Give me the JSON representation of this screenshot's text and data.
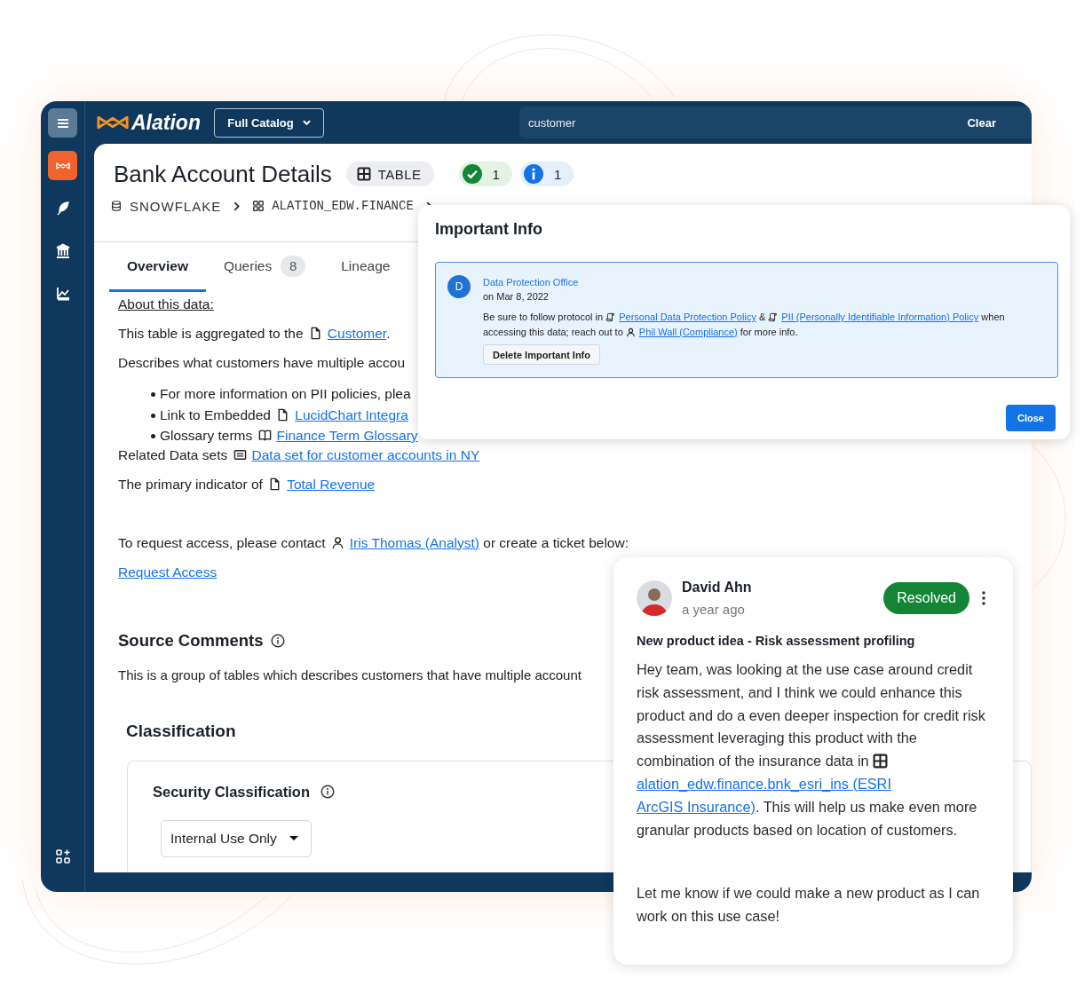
{
  "top_bar": {
    "logo": "Alation",
    "catalog_dropdown": "Full Catalog",
    "search": {
      "value": "customer"
    },
    "clear_button": "Clear"
  },
  "rail": [
    {
      "kind": "menu",
      "selected": false
    },
    {
      "kind": "catalog",
      "selected": true
    },
    {
      "kind": "compose",
      "selected": false
    },
    {
      "kind": "bank",
      "selected": false
    },
    {
      "kind": "chart",
      "selected": false
    },
    {
      "kind": "apps",
      "selected": false
    }
  ],
  "header": {
    "title": "Bank Account Details",
    "type_badge": "TABLE",
    "badges": [
      {
        "kind": "endorsed",
        "count": "1"
      },
      {
        "kind": "info",
        "count": "1"
      }
    ],
    "breadcrumb": [
      {
        "kind": "database",
        "label": "SNOWFLAKE"
      },
      {
        "kind": "schema",
        "label": "ALATION_EDW.FINANCE"
      }
    ]
  },
  "tabs": [
    {
      "label": "Overview",
      "selected": true
    },
    {
      "label": "Queries",
      "count": "8",
      "selected": false
    },
    {
      "label": "Lineage",
      "selected": false
    }
  ],
  "description": [
    {
      "kind": "label",
      "text": "About this data:"
    },
    {
      "kind": "para",
      "parts": [
        {
          "text": "This table is aggregated to the "
        },
        {
          "kind": "document"
        },
        {
          "link": "Customer"
        },
        {
          "text": "."
        }
      ]
    },
    {
      "kind": "para",
      "parts": [
        {
          "text": "Describes what customers have multiple accou"
        }
      ]
    },
    {
      "kind": "bullets",
      "items": [
        {
          "parts": [
            {
              "text": "For more information on PII policies, plea"
            }
          ]
        },
        {
          "parts": [
            {
              "text": "Link to Embedded "
            },
            {
              "kind": "document"
            },
            {
              "link": "LucidChart Integra"
            }
          ]
        },
        {
          "parts": [
            {
              "text": "Glossary terms "
            },
            {
              "kind": "book"
            },
            {
              "link": "Finance Term Glossary"
            }
          ]
        }
      ]
    },
    {
      "kind": "related",
      "parts": [
        {
          "text": "Related Data sets "
        },
        {
          "kind": "dataset"
        },
        {
          "link": "Data set for customer accounts in NY"
        }
      ]
    },
    {
      "kind": "para",
      "parts": [
        {
          "text": "The primary indicator of "
        },
        {
          "kind": "document"
        },
        {
          "link": "Total Revenue"
        }
      ]
    },
    {
      "kind": "contact",
      "parts": [
        {
          "text": "To request access, please contact "
        },
        {
          "kind": "person"
        },
        {
          "link": "Iris Thomas (Analyst)"
        },
        {
          "text": " or create a ticket below:"
        }
      ]
    },
    {
      "kind": "action",
      "text": "Request Access"
    }
  ],
  "source_comments": {
    "title": "Source Comments",
    "text": "This is a group of tables which describes customers that have multiple account"
  },
  "classification": {
    "title": "Classification",
    "field_label": "Security Classification",
    "value": "Internal Use Only"
  },
  "important_info": {
    "title": "Important Info",
    "initial": "D",
    "author": "Data Protection Office",
    "date": "on Mar 8, 2022",
    "parts": [
      {
        "text": "Be sure to follow protocol in "
      },
      {
        "kind": "policy"
      },
      {
        "link": "Personal Data Protection Policy"
      },
      {
        "text": " & "
      },
      {
        "kind": "policy"
      },
      {
        "link": "PII (Personally Identifiable Information) Policy"
      },
      {
        "text": "  when accessing this data; reach out to "
      },
      {
        "kind": "person"
      },
      {
        "link": "Phil Wall (Compliance)"
      },
      {
        "text": " for more info."
      }
    ],
    "delete_button": "Delete Important Info",
    "close_button": "Close"
  },
  "comment": {
    "author": "David Ahn",
    "time": "a year ago",
    "status": {
      "kind": "resolved",
      "label": "Resolved"
    },
    "subject": "New product idea - Risk assessment profiling",
    "paragraphs": [
      [
        {
          "text": "Hey team, was looking at the use case around credit risk assessment, and I think we could enhance this product and do a even deeper inspection for credit risk assessment leveraging this product with the combination of the insurance data in "
        },
        {
          "kind": "table"
        },
        {
          "link": "alation_edw.finance.bnk_esri_ins (ESRI"
        },
        {
          "link": "ArcGIS Insurance)"
        },
        {
          "text": ". This will help us make even more granular products based on location of customers."
        }
      ],
      [
        {
          "text": "Let me know if we could make a new product as I can work on this use case!"
        }
      ]
    ]
  }
}
